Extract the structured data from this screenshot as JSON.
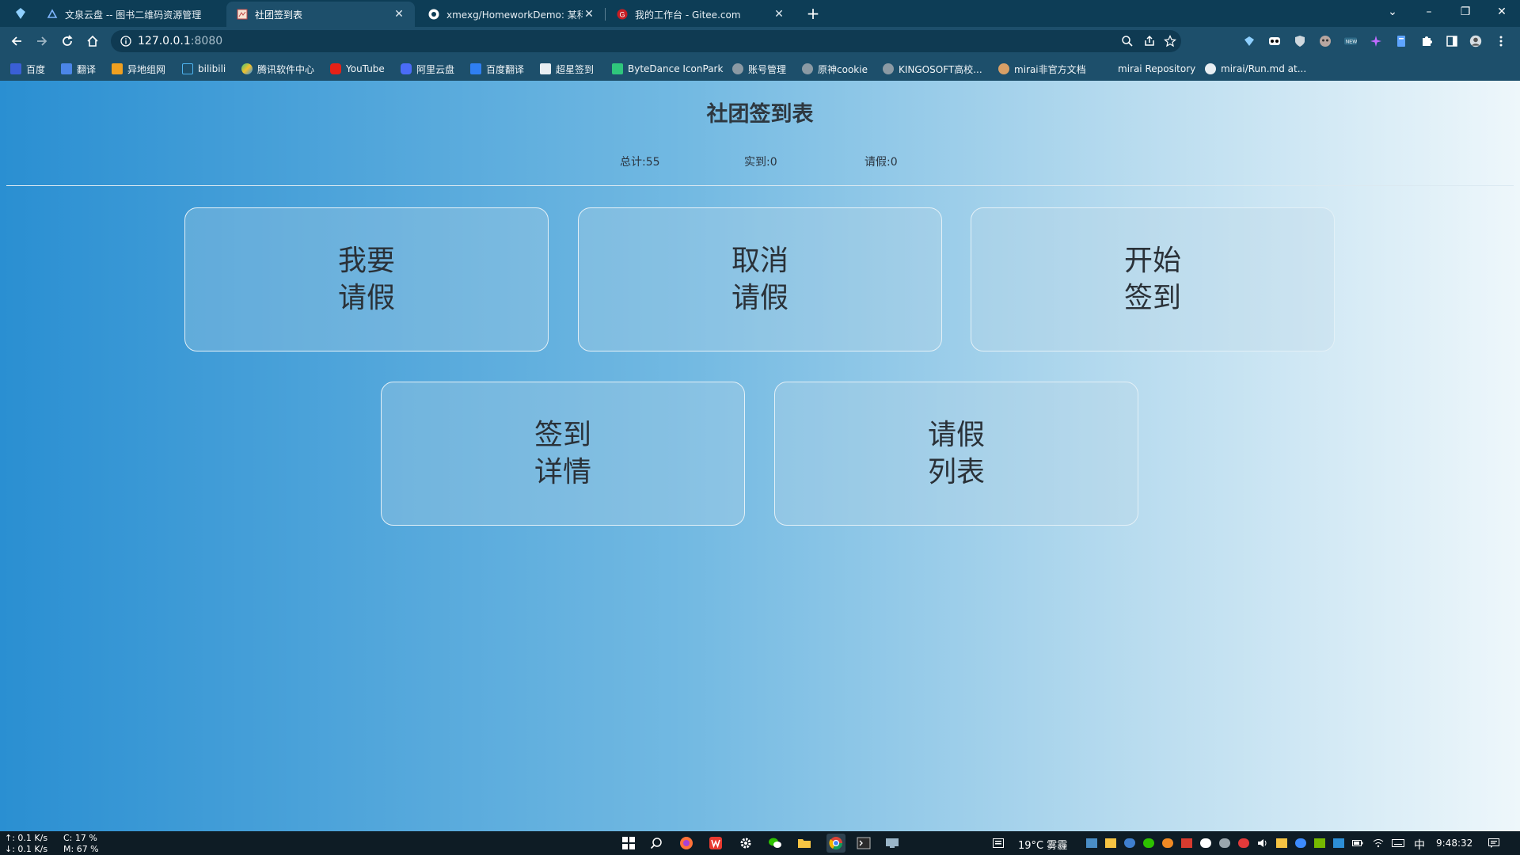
{
  "browser": {
    "tabs": [
      {
        "title": "文泉云盘 -- 图书二维码资源管理",
        "active": false
      },
      {
        "title": "社团签到表",
        "active": true
      },
      {
        "title": "xmexg/HomeworkDemo: 某科",
        "active": false
      },
      {
        "title": "我的工作台 - Gitee.com",
        "active": false
      }
    ],
    "new_tab": "+",
    "address": {
      "host": "127.0.0.1",
      "port": ":8080"
    },
    "bookmarks": [
      {
        "label": "百度"
      },
      {
        "label": "翻译"
      },
      {
        "label": "异地组网"
      },
      {
        "label": "bilibili"
      },
      {
        "label": "腾讯软件中心"
      },
      {
        "label": "YouTube"
      },
      {
        "label": "阿里云盘"
      },
      {
        "label": "百度翻译"
      },
      {
        "label": "超星签到"
      },
      {
        "label": "ByteDance IconPark"
      },
      {
        "label": "账号管理"
      },
      {
        "label": "原神cookie"
      },
      {
        "label": "KINGOSOFT高校..."
      },
      {
        "label": "mirai非官方文档"
      },
      {
        "label": "mirai Repository"
      },
      {
        "label": "mirai/Run.md at..."
      }
    ]
  },
  "page": {
    "title": "社团签到表",
    "stats": {
      "total": "总计:55",
      "present": "实到:0",
      "leave": "请假:0"
    },
    "cards": [
      {
        "label": "我要\n请假"
      },
      {
        "label": "取消\n请假"
      },
      {
        "label": "开始\n签到"
      },
      {
        "label": "签到\n详情"
      },
      {
        "label": "请假\n列表"
      }
    ]
  },
  "taskbar": {
    "net_up": "↑: 0.1 K/s",
    "net_down": "↓: 0.1 K/s",
    "cpu": "C: 17 %",
    "mem": "M: 67 %",
    "weather": "19°C 雾霾",
    "ime": "中",
    "time": "9:48:32"
  },
  "colors": {
    "tab_strip": "#0d3d56",
    "toolbar": "#1d4f6b",
    "page_gradient_start": "#2a8fd2",
    "page_gradient_end": "#eef7fb"
  }
}
